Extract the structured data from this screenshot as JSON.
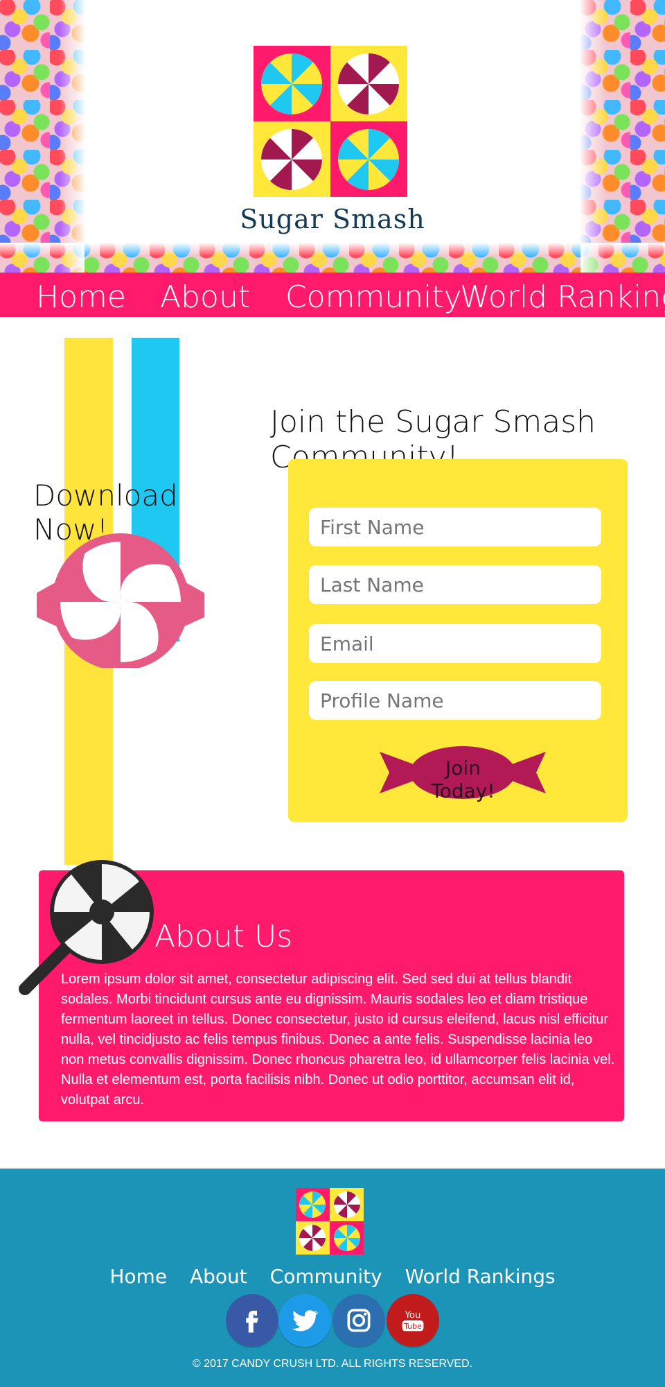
{
  "brand": {
    "name": "Sugar Smash",
    "colors": {
      "pink": "#ff1a6c",
      "yellow": "#ffe83a",
      "blue": "#1fc8f1",
      "navy": "#163a55",
      "footer_blue": "#1c94b7"
    }
  },
  "nav": {
    "items": [
      {
        "label": "Home"
      },
      {
        "label": "About"
      },
      {
        "label": "Community"
      },
      {
        "label": "World Rankings"
      }
    ]
  },
  "download": {
    "title": "Download Now!",
    "icon": "candy-icon"
  },
  "signup": {
    "title": "Join the Sugar Smash Community!",
    "fields": {
      "first_name_placeholder": "First Name",
      "last_name_placeholder": "Last Name",
      "email_placeholder": "Email",
      "profile_name_placeholder": "Profile Name"
    },
    "button_label": "Join Today!"
  },
  "about": {
    "title": "About Us",
    "body": "Lorem ipsum dolor sit amet, consectetur adipiscing elit. Sed sed dui at tellus blandit sodales. Morbi tincidunt cursus ante eu dignissim. Mauris sodales leo et diam tristique fermentum laoreet in tellus. Donec consectetur, justo id cursus eleifend, lacus nisl efficitur nulla, vel tincidjusto ac felis tempus finibus. Donec a ante felis. Suspendisse lacinia leo non metus convallis dignissim. Donec rhoncus pharetra leo, id ullamcorper felis lacinia vel. Nulla et elementum est, porta facilisis nibh. Donec ut odio porttitor, accumsan elit id, volutpat arcu.",
    "icon": "lollipop-icon"
  },
  "footer": {
    "nav": [
      {
        "label": "Home"
      },
      {
        "label": "About"
      },
      {
        "label": "Community"
      },
      {
        "label": "World Rankings"
      }
    ],
    "social": [
      {
        "name": "facebook-icon",
        "label": "f"
      },
      {
        "name": "twitter-icon",
        "label": "🐦"
      },
      {
        "name": "instagram-icon",
        "label": "◎"
      },
      {
        "name": "youtube-icon",
        "label": "You Tube"
      }
    ],
    "copyright": "© 2017 CANDY CRUSH LTD. ALL RIGHTS RESERVED."
  }
}
